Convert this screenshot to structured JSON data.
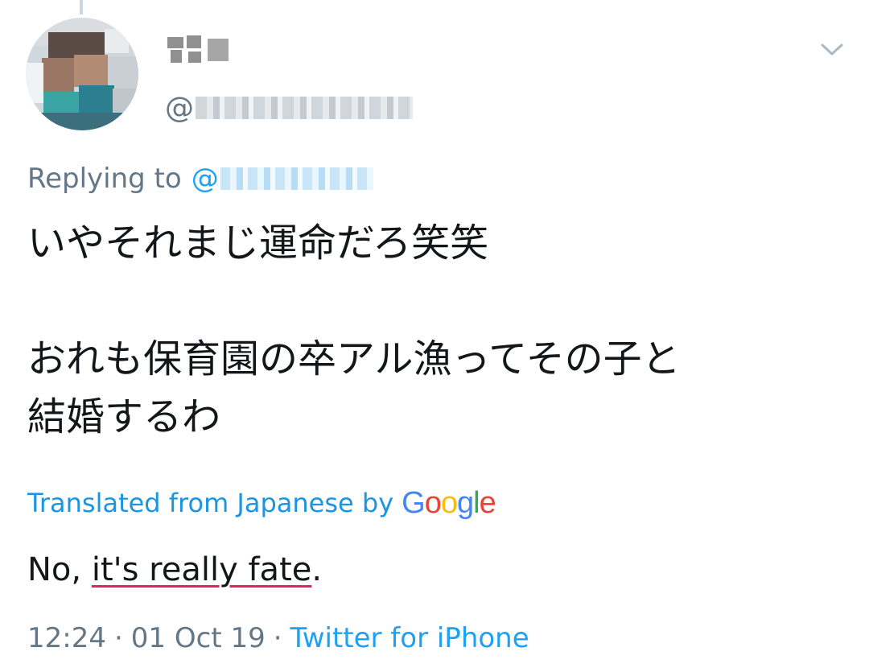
{
  "tweet": {
    "handle_prefix": "@",
    "reply_prefix": "Replying to",
    "reply_at": "@",
    "text_lines": [
      "いやそれまじ運命だろ笑笑",
      "おれも保育園の卒アル漁ってその子と",
      "結婚するわ"
    ],
    "translated_label": "Translated from Japanese by",
    "translation_before": "No, ",
    "translation_underlined": "it's really fate",
    "translation_after": ".",
    "time": "12:24",
    "date": "01 Oct 19",
    "separator": "·",
    "source": "Twitter for iPhone"
  },
  "brand": {
    "google": [
      "G",
      "o",
      "o",
      "g",
      "l",
      "e"
    ]
  },
  "colors": {
    "link": "#1da1f2",
    "secondary_text": "#657786",
    "primary_text": "#14171a",
    "spell_underline": "#e0245e"
  },
  "icons": {
    "menu": "chevron-down-icon"
  }
}
